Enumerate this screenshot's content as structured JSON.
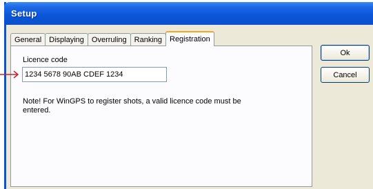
{
  "window": {
    "title": "Setup"
  },
  "tabs": [
    {
      "label": "General",
      "active": false
    },
    {
      "label": "Displaying",
      "active": false
    },
    {
      "label": "Overruling",
      "active": false
    },
    {
      "label": "Ranking",
      "active": false
    },
    {
      "label": "Registration",
      "active": true
    }
  ],
  "registration": {
    "licence_label": "Licence code",
    "licence_value": "1234 5678 90AB CDEF 1234",
    "note_text": "Note! For WinGPS to register shots, a valid licence code must be entered."
  },
  "buttons": {
    "ok_label": "Ok",
    "cancel_label": "Cancel"
  },
  "colors": {
    "titlebar": "#0b56d8",
    "arrow": "#d0202a",
    "active_tab_highlight": "#f5a623"
  },
  "icons": {
    "pointer": "arrow-right-icon"
  }
}
